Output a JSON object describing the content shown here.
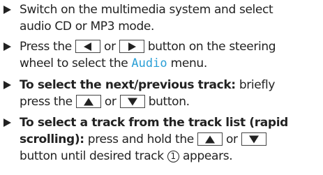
{
  "steps": [
    {
      "line1": "Switch on the multimedia system and select",
      "line2": "audio CD or MP3 mode."
    },
    {
      "line1_a": "Press the",
      "line1_or": "or",
      "line1_b": "button on the steering",
      "line2_a": "wheel to select the",
      "menu_name": "Audio",
      "line2_b": "menu.",
      "key_left_icon": "triangle-left-icon",
      "key_right_icon": "triangle-right-icon"
    },
    {
      "bold_label": "To select the next/previous track:",
      "line1_rest": "briefly",
      "line2_a": "press the",
      "line2_or": "or",
      "line2_b": "button.",
      "key_up_icon": "triangle-up-icon",
      "key_down_icon": "triangle-down-icon"
    },
    {
      "bold_line1": "To select a track from the track list (rapid",
      "bold_line2": "scrolling):",
      "line2_a": "press and hold the",
      "line2_or": "or",
      "line3_a": "button until desired track",
      "marker": "1",
      "line3_b": "appears."
    }
  ],
  "colors": {
    "text": "#222222",
    "menu_highlight": "#2a9fd6"
  }
}
